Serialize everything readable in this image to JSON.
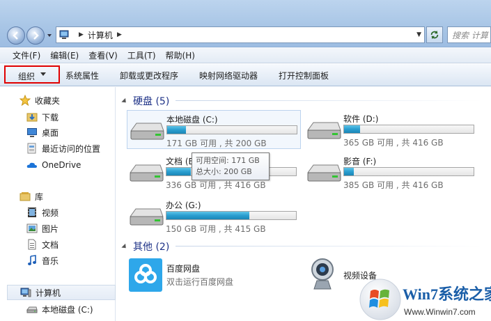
{
  "window": {
    "address": {
      "crumb": "计算机"
    },
    "search_placeholder": "搜索 计算"
  },
  "menu": [
    "文件(F)",
    "编辑(E)",
    "查看(V)",
    "工具(T)",
    "帮助(H)"
  ],
  "toolbar": {
    "organize": "组织",
    "items": [
      "系统属性",
      "卸载或更改程序",
      "映射网络驱动器",
      "打开控制面板"
    ]
  },
  "sidebar": {
    "favorites_label": "收藏夹",
    "favorites": [
      "下载",
      "桌面",
      "最近访问的位置"
    ],
    "onedrive": "OneDrive",
    "libraries_label": "库",
    "libraries": [
      "视频",
      "图片",
      "文档",
      "音乐"
    ],
    "computer": "计算机",
    "computer_child": "本地磁盘 (C:)"
  },
  "groups": {
    "drives_header": "硬盘 (5)",
    "other_header": "其他 (2)"
  },
  "drives": [
    {
      "name": "本地磁盘 (C:)",
      "info": "171 GB 可用 , 共 200 GB",
      "used": 0.145
    },
    {
      "name": "软件 (D:)",
      "info": "365 GB 可用 , 共 416 GB",
      "used": 0.123
    },
    {
      "name": "文档 (E",
      "info": "336 GB 可用 , 共 416 GB",
      "used": 0.19
    },
    {
      "name": "影音 (F:)",
      "info": "385 GB 可用 , 共 416 GB",
      "used": 0.075
    },
    {
      "name": "办公 (G:)",
      "info": "150 GB 可用 , 共 415 GB",
      "used": 0.64
    }
  ],
  "tooltip": {
    "line1": "可用空间: 171 GB",
    "line2": "总大小: 200 GB"
  },
  "other": [
    {
      "name": "百度网盘",
      "sub": "双击运行百度网盘"
    },
    {
      "name": "视频设备"
    }
  ],
  "watermark": {
    "brand": "Win7系统之家",
    "url": "Www.Winwin7.com"
  },
  "colors": {
    "highlight_border": "#e00000",
    "bar_fill": "#2a9ed0",
    "group_header": "#1e3287"
  }
}
